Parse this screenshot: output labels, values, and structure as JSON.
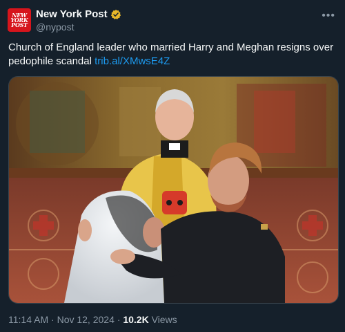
{
  "account": {
    "avatar_text": "NEW YORK POST",
    "display_name": "New York Post",
    "handle": "@nypost",
    "verified_badge": "verified-gold-badge"
  },
  "tweet": {
    "text": "Church of England leader who married Harry and Meghan resigns over pedophile scandal",
    "link": "trib.al/XMwsE4Z",
    "time": "11:14 AM",
    "date": "Nov 12, 2024",
    "views_count": "10.2K",
    "views_label": "Views",
    "separator": "·"
  },
  "ui": {
    "more_icon": "more-icon",
    "more_glyph": "•••"
  },
  "colors": {
    "background": "#15202b",
    "text": "#f7f9f9",
    "muted": "#8b98a5",
    "link": "#1d9bf0",
    "brand_red": "#d6151c",
    "verified_gold": "#e8b829"
  }
}
